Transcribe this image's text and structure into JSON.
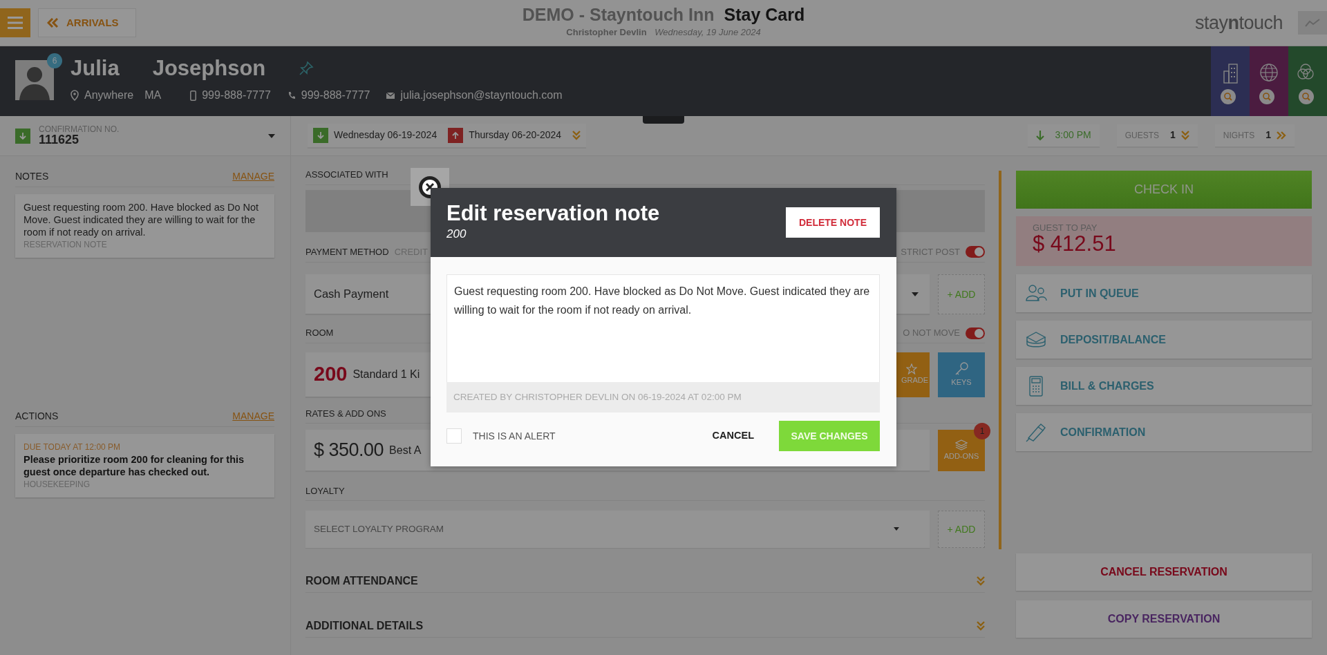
{
  "top_bar": {
    "back_button": "ARRIVALS",
    "hotel": "DEMO - Stayntouch Inn",
    "page_title": "Stay Card",
    "user": "Christopher Devlin",
    "date": "Wednesday, 19 June 2024",
    "logo": "stay**n**touch"
  },
  "guest": {
    "first_name": "Julia",
    "last_name": "Josephson",
    "badge": "6",
    "city": "Anywhere",
    "state": "MA",
    "mobile": "999-888-7777",
    "phone": "999-888-7777",
    "email": "julia.josephson@stayntouch.com"
  },
  "reservation_bar": {
    "confirmation_label": "CONFIRMATION NO.",
    "confirmation_number": "111625",
    "arrival": "Wednesday 06-19-2024",
    "departure": "Thursday 06-20-2024",
    "arrival_time": "3:00 PM",
    "guests_label": "GUESTS",
    "guests": "1",
    "nights_label": "NIGHTS",
    "nights": "1"
  },
  "notes": {
    "title": "NOTES",
    "manage": "MANAGE",
    "items": [
      {
        "text": "Guest requesting room 200. Have blocked as Do Not Move. Guest indicated they are willing to wait for the room if not ready on arrival.",
        "type": "RESERVATION NOTE"
      }
    ]
  },
  "actions": {
    "title": "ACTIONS",
    "manage": "MANAGE",
    "items": [
      {
        "due": "DUE TODAY AT 12:00 PM",
        "text": "Please prioritize room 200 for cleaning for this guest once departure has checked out.",
        "department": "HOUSEKEEPING"
      }
    ]
  },
  "details": {
    "associated_label": "ASSOCIATED WITH",
    "payment_label": "PAYMENT METHOD",
    "payment_tab": "CREDIT",
    "payment_value": "Cash Payment",
    "restrict_post": {
      "label": "STRICT POST",
      "on": true
    },
    "payment_add": "+ ADD",
    "room_label": "ROOM",
    "do_not_move": {
      "label": "O NOT MOVE",
      "on": true
    },
    "room_number": "200",
    "room_type": "Standard 1 Ki",
    "upgrade": "GRADE",
    "keys": "KEYS",
    "rates_label": "RATES & ADD ONS",
    "rate_amount": "$ 350.00",
    "rate_name": "Best A",
    "addons": "ADD-ONS",
    "addons_badge": "1",
    "loyalty_label": "LOYALTY",
    "loyalty_placeholder": "SELECT LOYALTY PROGRAM",
    "loyalty_add": "+ ADD",
    "sections": [
      {
        "title": "ROOM ATTENDANCE"
      },
      {
        "title": "ADDITIONAL DETAILS"
      }
    ]
  },
  "side": {
    "check_in": "CHECK IN",
    "balance_label": "GUEST TO PAY",
    "balance": "$ 412.51",
    "items": [
      {
        "kind": "queue",
        "label": "PUT IN QUEUE"
      },
      {
        "kind": "deposit",
        "label": "DEPOSIT/BALANCE"
      },
      {
        "kind": "bill",
        "label": "BILL & CHARGES"
      },
      {
        "kind": "confirmation",
        "label": "CONFIRMATION"
      }
    ],
    "cancel": "CANCEL RESERVATION",
    "copy": "COPY RESERVATION"
  },
  "modal": {
    "title": "Edit reservation note",
    "subtitle": "200",
    "delete": "DELETE NOTE",
    "note_text": "Guest requesting room 200. Have blocked as Do Not Move. Guest indicated they are willing to wait for the room if not ready on arrival.",
    "created": "CREATED BY CHRISTOPHER DEVLIN ON 06-19-2024 AT 02:00 PM",
    "alert": {
      "label": "THIS IS AN ALERT",
      "checked": false
    },
    "cancel": "CANCEL",
    "save": "SAVE CHANGES"
  }
}
